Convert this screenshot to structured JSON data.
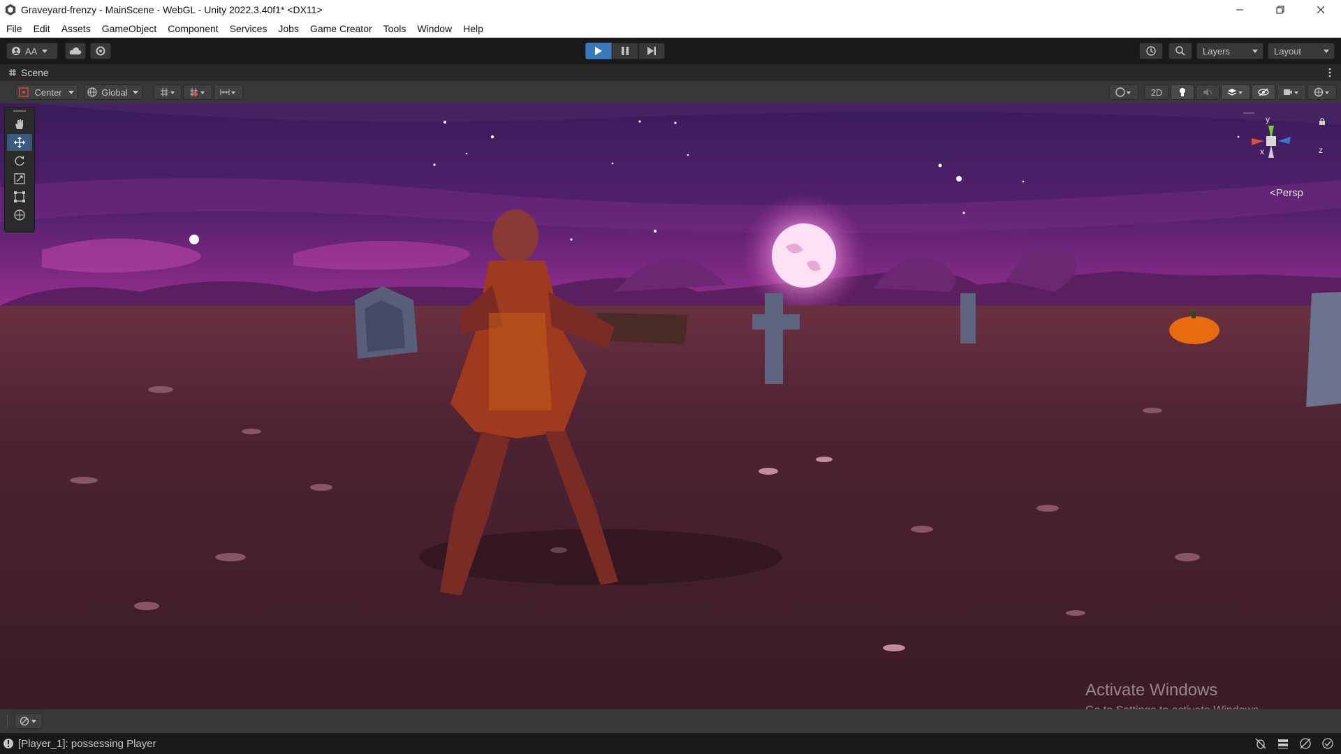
{
  "window": {
    "title": "Graveyard-frenzy - MainScene - WebGL - Unity 2022.3.40f1* <DX11>",
    "controls": [
      "minimize",
      "restore",
      "close"
    ]
  },
  "menu": [
    "File",
    "Edit",
    "Assets",
    "GameObject",
    "Component",
    "Services",
    "Jobs",
    "Game Creator",
    "Tools",
    "Window",
    "Help"
  ],
  "toolbar": {
    "account_label": "AA",
    "layers_label": "Layers",
    "layout_label": "Layout"
  },
  "scene_tab": {
    "label": "Scene"
  },
  "scene_options": {
    "pivot_label": "Center",
    "space_label": "Global",
    "mode_2d_label": "2D"
  },
  "gizmo": {
    "x_label": "x",
    "y_label": "y",
    "z_label": "z",
    "projection_label": "Persp"
  },
  "activation": {
    "title": "Activate Windows",
    "subtitle": "Go to Settings to activate Windows."
  },
  "status": {
    "message": "[Player_1]: possessing Player"
  },
  "colors": {
    "accent": "#3a79bb",
    "sky_top": "#3a1c5a",
    "sky_horizon": "#b23a9a",
    "ground": "#4d2333"
  }
}
